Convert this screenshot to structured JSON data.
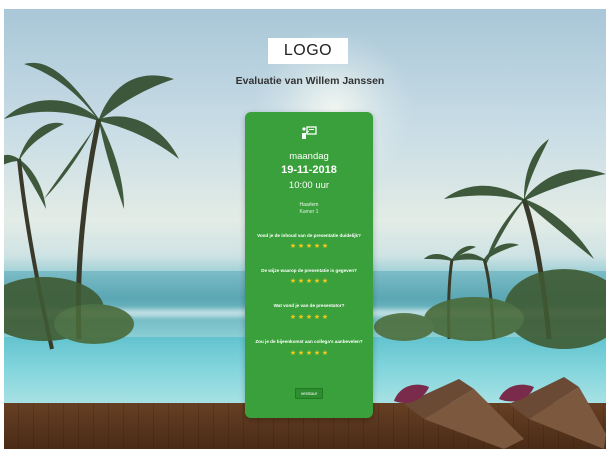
{
  "header": {
    "logo_text": "LOGO",
    "title": "Evaluatie van Willem Janssen"
  },
  "session": {
    "icon": "presenter-board-icon",
    "day": "maandag",
    "date": "19-11-2018",
    "time": "10:00 uur",
    "city": "Haarlem",
    "room": "Kamer 1"
  },
  "questions": [
    {
      "text": "Vond je de inhoud van de presentatie duidelijk?",
      "rating": 5,
      "max": 5
    },
    {
      "text": "De wijze waarop de presentatie is gegeven?",
      "rating": 5,
      "max": 5
    },
    {
      "text": "Wat vond je van de presentator?",
      "rating": 5,
      "max": 5
    },
    {
      "text": "Zou je de bijeenkomst aan collega's aanbevelen?",
      "rating": 5,
      "max": 5
    }
  ],
  "actions": {
    "next_label": "verstuur"
  },
  "colors": {
    "card": "#3aa03b",
    "star": "#f7c81c"
  }
}
